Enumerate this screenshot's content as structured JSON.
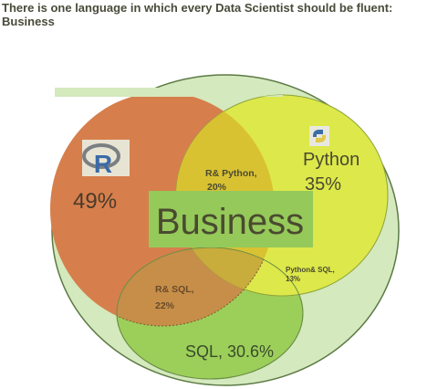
{
  "heading": {
    "line1": "There is one language in which every Data Scientist should be fluent:",
    "line2": "Business"
  },
  "diagram": {
    "center_label": "Business",
    "r": {
      "icon": "r-logo-icon",
      "percent": "49%"
    },
    "python": {
      "icon": "python-logo-icon",
      "name": "Python",
      "percent": "35%"
    },
    "r_python": {
      "line1": "R& Python,",
      "line2": "20%"
    },
    "r_sql": {
      "line1": "R& SQL,",
      "line2": "22%"
    },
    "python_sql": {
      "line1": "Python& SQL,",
      "line2": "13%"
    },
    "sql": {
      "label": "SQL, 30.6%"
    },
    "colors": {
      "outer": "#d4e9bd",
      "r": "#d67f4c",
      "python": "#dde84a",
      "r_python": "#d9c232",
      "sql": "#9ccf5a",
      "business_box": "#95c95a",
      "business_text": "#4a4a30"
    }
  }
}
